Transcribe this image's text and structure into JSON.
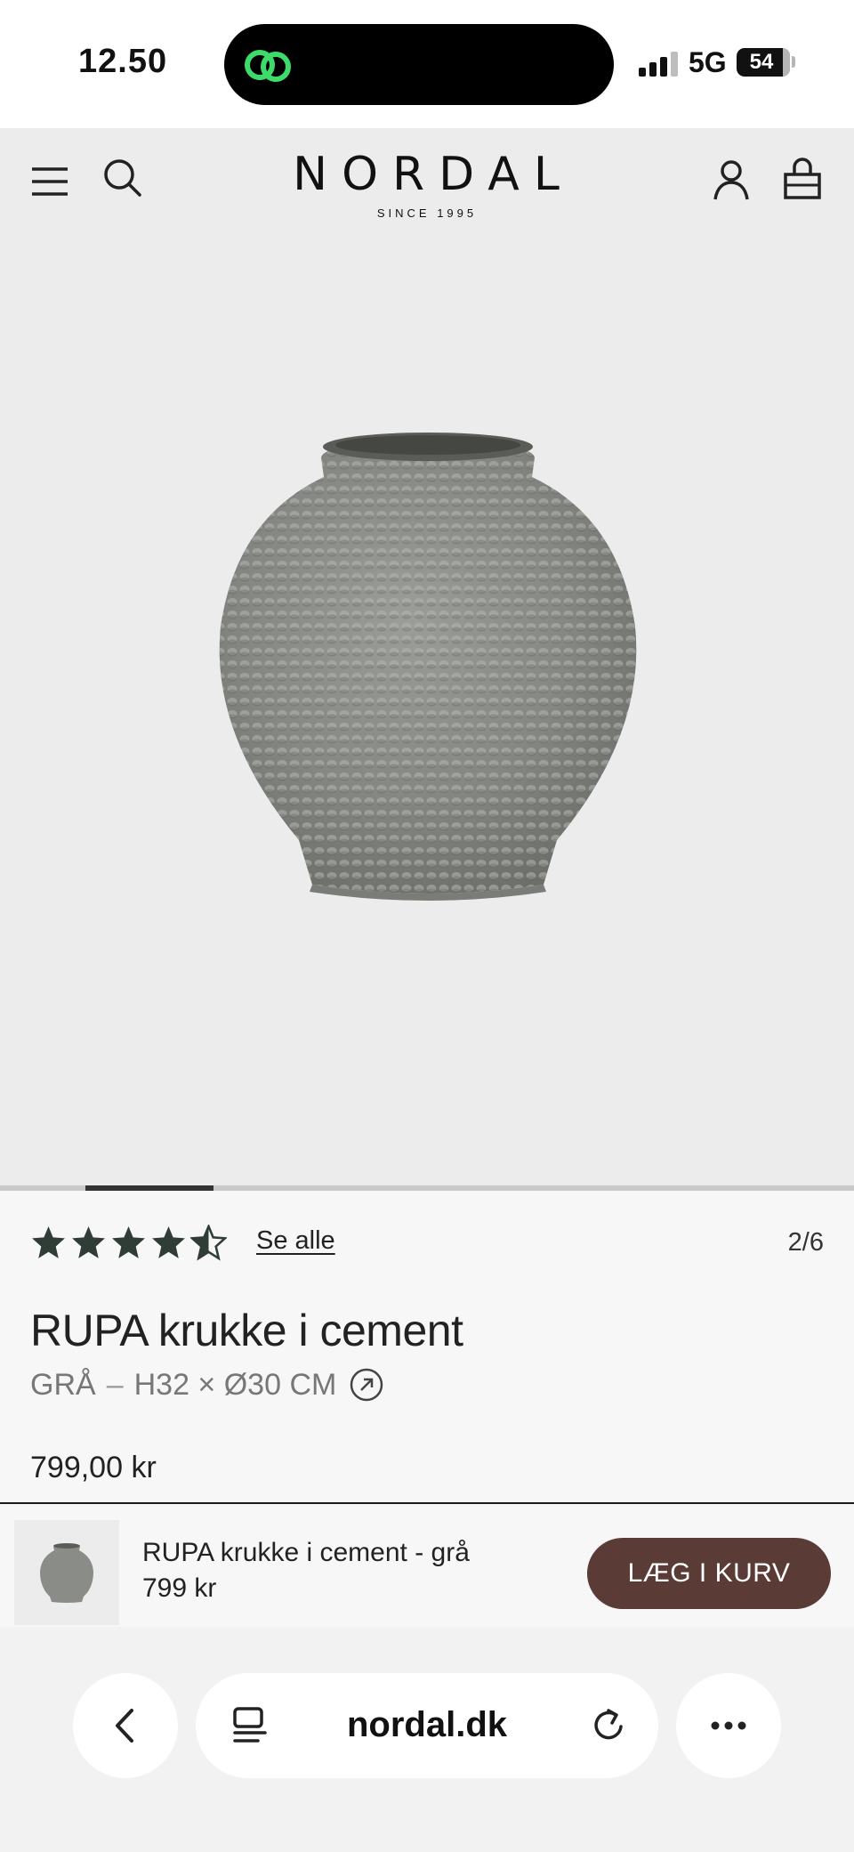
{
  "status_bar": {
    "time": "12.50",
    "network": "5G",
    "battery": "54",
    "battery_level": 0.54,
    "signal_bars": 3
  },
  "header": {
    "logo": "NORDAL",
    "tagline": "SINCE 1995",
    "icons": [
      "menu-icon",
      "search-icon",
      "account-icon",
      "bag-icon"
    ]
  },
  "gallery": {
    "image_index": 2,
    "image_count": 6
  },
  "product": {
    "rating": 4.5,
    "rating_max": 5,
    "see_all": "Se alle",
    "image_counter": "2/6",
    "title": "RUPA krukke i cement",
    "color": "GRÅ",
    "separator": "–",
    "dimensions": "H32 × Ø30 CM",
    "price": "799,00 kr"
  },
  "cart_bar": {
    "name": "RUPA krukke i cement - grå",
    "price": "799 kr",
    "button": "LÆG I KURV",
    "button_color": "#5a3b36"
  },
  "browser": {
    "url": "nordal.dk"
  }
}
